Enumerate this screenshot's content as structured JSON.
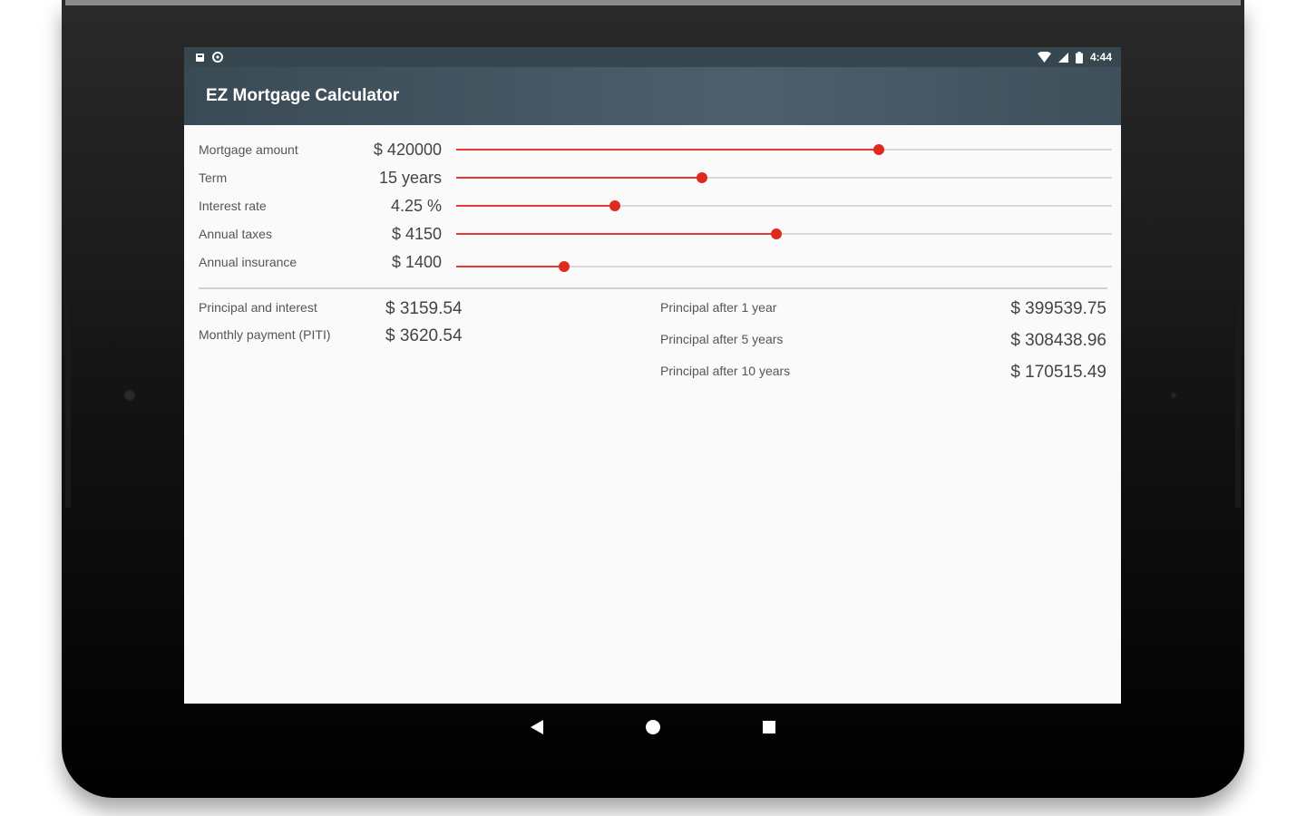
{
  "status_bar": {
    "time": "4:44",
    "left_icons": [
      "notification-icon",
      "sync-icon"
    ],
    "right_icons": [
      "wifi-icon",
      "signal-icon",
      "battery-icon"
    ]
  },
  "app": {
    "title": "EZ Mortgage Calculator"
  },
  "inputs": [
    {
      "id": "mortgage-amount",
      "label": "Mortgage amount",
      "value": "$ 420000",
      "level": 0.645
    },
    {
      "id": "term",
      "label": "Term",
      "value": "15 years",
      "level": 0.375
    },
    {
      "id": "interest-rate",
      "label": "Interest rate",
      "value": "4.25 %",
      "level": 0.242
    },
    {
      "id": "annual-taxes",
      "label": "Annual taxes",
      "value": "$ 4150",
      "level": 0.488
    },
    {
      "id": "annual-insurance",
      "label": "Annual insurance",
      "value": "$ 1400",
      "level": 0.165
    }
  ],
  "results_left": [
    {
      "label": "Principal and interest",
      "value": "$ 3159.54"
    },
    {
      "label": "Monthly payment (PITI)",
      "value": "$ 3620.54"
    }
  ],
  "results_right": [
    {
      "label": "Principal after 1 year",
      "value": "$ 399539.75"
    },
    {
      "label": "Principal after 5 years",
      "value": "$ 308438.96"
    },
    {
      "label": "Principal after 10 years",
      "value": "$ 170515.49"
    }
  ],
  "nav": [
    "back-icon",
    "home-icon",
    "recents-icon"
  ],
  "colors": {
    "accent": "#e02a1f",
    "toolbar": "#455a64",
    "statusbar": "#37474f"
  }
}
